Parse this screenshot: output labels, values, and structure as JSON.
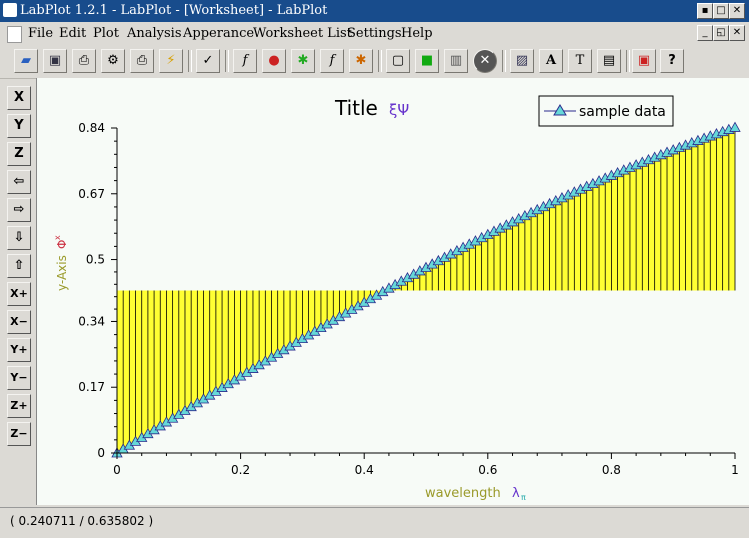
{
  "window": {
    "title": "LabPlot 1.2.1 - LabPlot - [Worksheet] - LabPlot"
  },
  "menu": [
    "File",
    "Edit",
    "Plot",
    "Analysis",
    "Apperance",
    "Worksheet List",
    "Settings",
    "Help"
  ],
  "plot": {
    "title": "Title",
    "title_suffix": "ξΨ",
    "xlabel": "wavelength",
    "xlabel_suffix": "λ",
    "xlabel_sub": "π",
    "ylabel": "y-Axis",
    "ylabel_suffix": "Φ",
    "ylabel_sup": "x",
    "legend": "sample data",
    "x_ticks": [
      "0",
      "0.2",
      "0.4",
      "0.6",
      "0.8",
      "1"
    ],
    "y_ticks": [
      "0",
      "0.17",
      "0.34",
      "0.5",
      "0.67",
      "0.84"
    ]
  },
  "chart_data": {
    "type": "line",
    "title": "Title ξΨ",
    "xlabel": "wavelength λπ",
    "ylabel": "y-Axis Φx",
    "xlim": [
      0,
      1
    ],
    "ylim": [
      0,
      0.84
    ],
    "fill_baseline": 0.42,
    "fill_color": "#ffff33",
    "line_color": "#2a2a8c",
    "marker": "triangle",
    "marker_color": "#66d8d8",
    "series": [
      {
        "name": "sample data",
        "function": "sin(x)",
        "x_start": 0,
        "x_end": 1,
        "count": 101
      }
    ],
    "legend_position": "top-right",
    "grid": false
  },
  "status": {
    "text": "( 0.240711 / 0.635802 )"
  },
  "colors": {
    "titlebar": "#184c8c",
    "plot_bg": "#f7fbf7",
    "fill": "#ffff33",
    "accent_purple": "#6633cc",
    "label_olive": "#9a9a2a"
  }
}
